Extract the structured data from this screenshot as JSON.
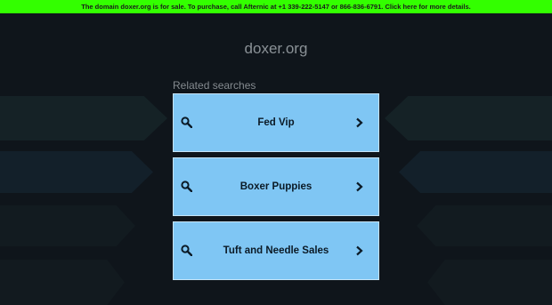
{
  "banner": {
    "text": "The domain doxer.org is for sale. To purchase, call Afternic at +1 339-222-5147 or 866-836-6791. Click here for more details."
  },
  "site": {
    "title": "doxer.org"
  },
  "related": {
    "label": "Related searches",
    "items": [
      {
        "label": "Fed Vip"
      },
      {
        "label": "Boxer Puppies"
      },
      {
        "label": "Tuft and Needle Sales"
      }
    ]
  },
  "colors": {
    "banner_bg": "#33ff00",
    "page_bg": "#0f151b",
    "result_bg": "#7fc6f4",
    "decor": "#152226"
  },
  "icons": {
    "search": "search-icon",
    "chevron": "chevron-right-icon"
  }
}
